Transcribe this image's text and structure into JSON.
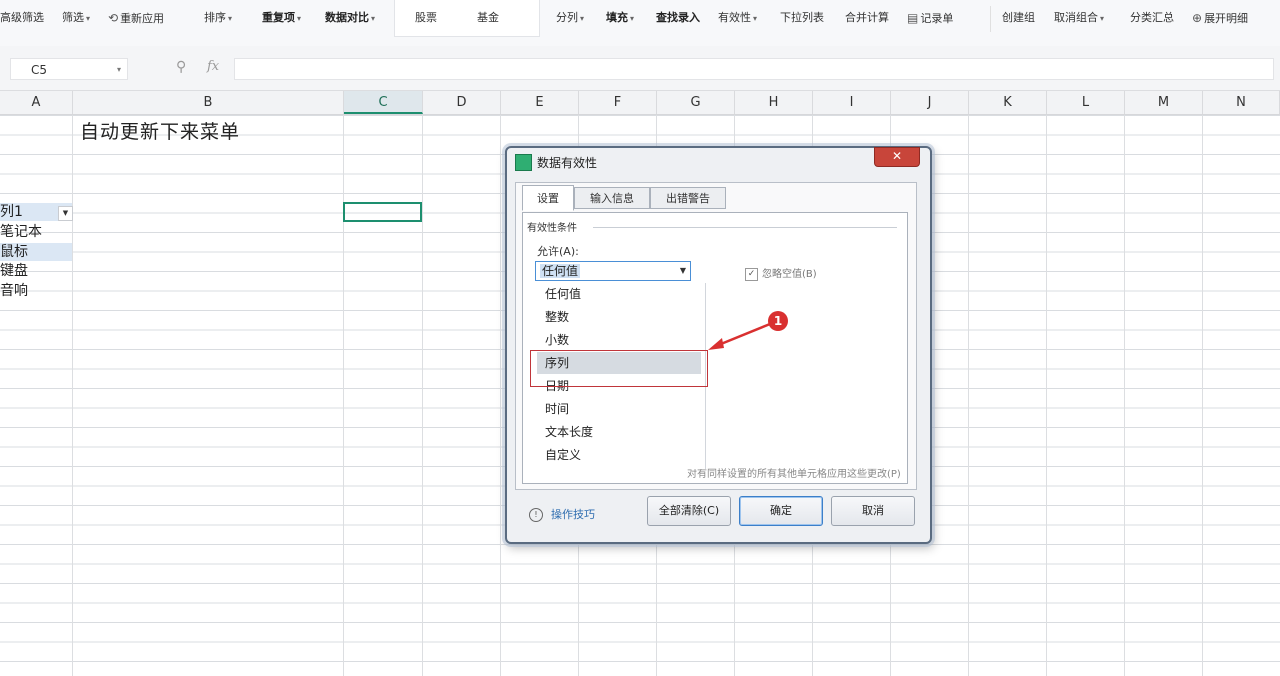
{
  "toolbar": {
    "items": [
      {
        "label": "高级筛选",
        "caret": false
      },
      {
        "label": "筛选",
        "caret": true
      },
      {
        "label": "重新应用",
        "caret": false
      },
      {
        "label": "排序",
        "caret": true
      },
      {
        "label": "重复项",
        "caret": true
      },
      {
        "label": "数据对比",
        "caret": true
      },
      {
        "label": "股票",
        "caret": false
      },
      {
        "label": "基金",
        "caret": false
      },
      {
        "label": "分列",
        "caret": true
      },
      {
        "label": "填充",
        "caret": true
      },
      {
        "label": "查找录入",
        "caret": false
      },
      {
        "label": "有效性",
        "caret": true
      },
      {
        "label": "下拉列表",
        "caret": false
      },
      {
        "label": "合并计算",
        "caret": false
      },
      {
        "label": "记录单",
        "caret": false
      },
      {
        "label": "创建组",
        "caret": false
      },
      {
        "label": "取消组合",
        "caret": true
      },
      {
        "label": "分类汇总",
        "caret": false
      },
      {
        "label": "展开明细",
        "caret": false
      }
    ]
  },
  "formula_bar": {
    "name_box": "C5",
    "fx_label": "fx",
    "formula": ""
  },
  "sheet": {
    "columns": [
      "A",
      "B",
      "C",
      "D",
      "E",
      "F",
      "G",
      "H",
      "I",
      "J",
      "K",
      "L",
      "M",
      "N"
    ],
    "selected_column": "C",
    "b1_text": "自动更新下来菜单",
    "column_a_items": [
      "列1",
      "笔记本",
      "鼠标",
      "键盘",
      "音响"
    ]
  },
  "dialog": {
    "title": "数据有效性",
    "close_label": "✕",
    "tabs": [
      "设置",
      "输入信息",
      "出错警告"
    ],
    "section_label": "有效性条件",
    "allow_label": "允许(A):",
    "allow_value": "任何值",
    "ignore_blank_label": "忽略空值(B)",
    "ignore_blank_checked": true,
    "apply_all_label": "对有同样设置的所有其他单元格应用这些更改(P)",
    "allow_options": [
      "任何值",
      "整数",
      "小数",
      "序列",
      "日期",
      "时间",
      "文本长度",
      "自定义"
    ],
    "highlighted_option": "序列",
    "tips_label": "操作技巧",
    "buttons": {
      "clear_all": "全部清除(C)",
      "ok": "确定",
      "cancel": "取消"
    }
  },
  "annotation": {
    "badge": "1",
    "color": "#d93030"
  }
}
